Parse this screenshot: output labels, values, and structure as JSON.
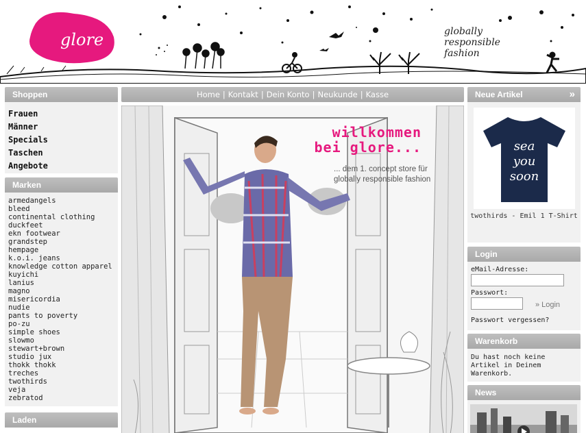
{
  "header": {
    "logo_text": "glore",
    "tagline": [
      "globally",
      "responsible",
      "fashion"
    ]
  },
  "left": {
    "shop_title": "Shoppen",
    "shop_items": [
      "Frauen",
      "Männer",
      "Specials",
      "Taschen",
      "Angebote"
    ],
    "brands_title": "Marken",
    "brands": [
      "armedangels",
      "bleed",
      "continental clothing",
      "duckfeet",
      "ekn footwear",
      "grandstep",
      "hempage",
      "k.o.i. jeans",
      "knowledge cotton apparel",
      "kuyichi",
      "lanius",
      "magno",
      "misericordia",
      "nudie",
      "pants to poverty",
      "po-zu",
      "simple shoes",
      "slowmo",
      "stewart+brown",
      "studio jux",
      "thokk thokk",
      "treches",
      "twothirds",
      "veja",
      "zebratod"
    ],
    "laden_title": "Laden"
  },
  "topnav": {
    "links": [
      "Home",
      "Kontakt",
      "Dein Konto",
      "Neukunde",
      "Kasse"
    ],
    "separator": "|"
  },
  "hero": {
    "welcome_line1": "willkommen",
    "welcome_line2": "bei glore...",
    "sub_line1": "... dem 1. concept store für",
    "sub_line2": "globally responsible fashion"
  },
  "right": {
    "new_title": "Neue Artikel",
    "more_glyph": "»",
    "product_shirt_text": [
      "sea",
      "you",
      "soon"
    ],
    "product_name": "twothirds - Emil 1 T-Shirt",
    "login_title": "Login",
    "email_label": "eMail-Adresse:",
    "email_value": "",
    "password_label": "Passwort:",
    "password_value": "",
    "login_button": "Login",
    "forgot_link": "Passwort vergessen?",
    "cart_title": "Warenkorb",
    "cart_text": "Du hast noch keine Artikel in Deinem Warenkorb.",
    "news_title": "News"
  },
  "colors": {
    "brand_pink": "#e6197e",
    "box_grey": "#b3b3b3",
    "box_bg": "#f1f1f1",
    "shirt_navy": "#1b2a4a"
  }
}
